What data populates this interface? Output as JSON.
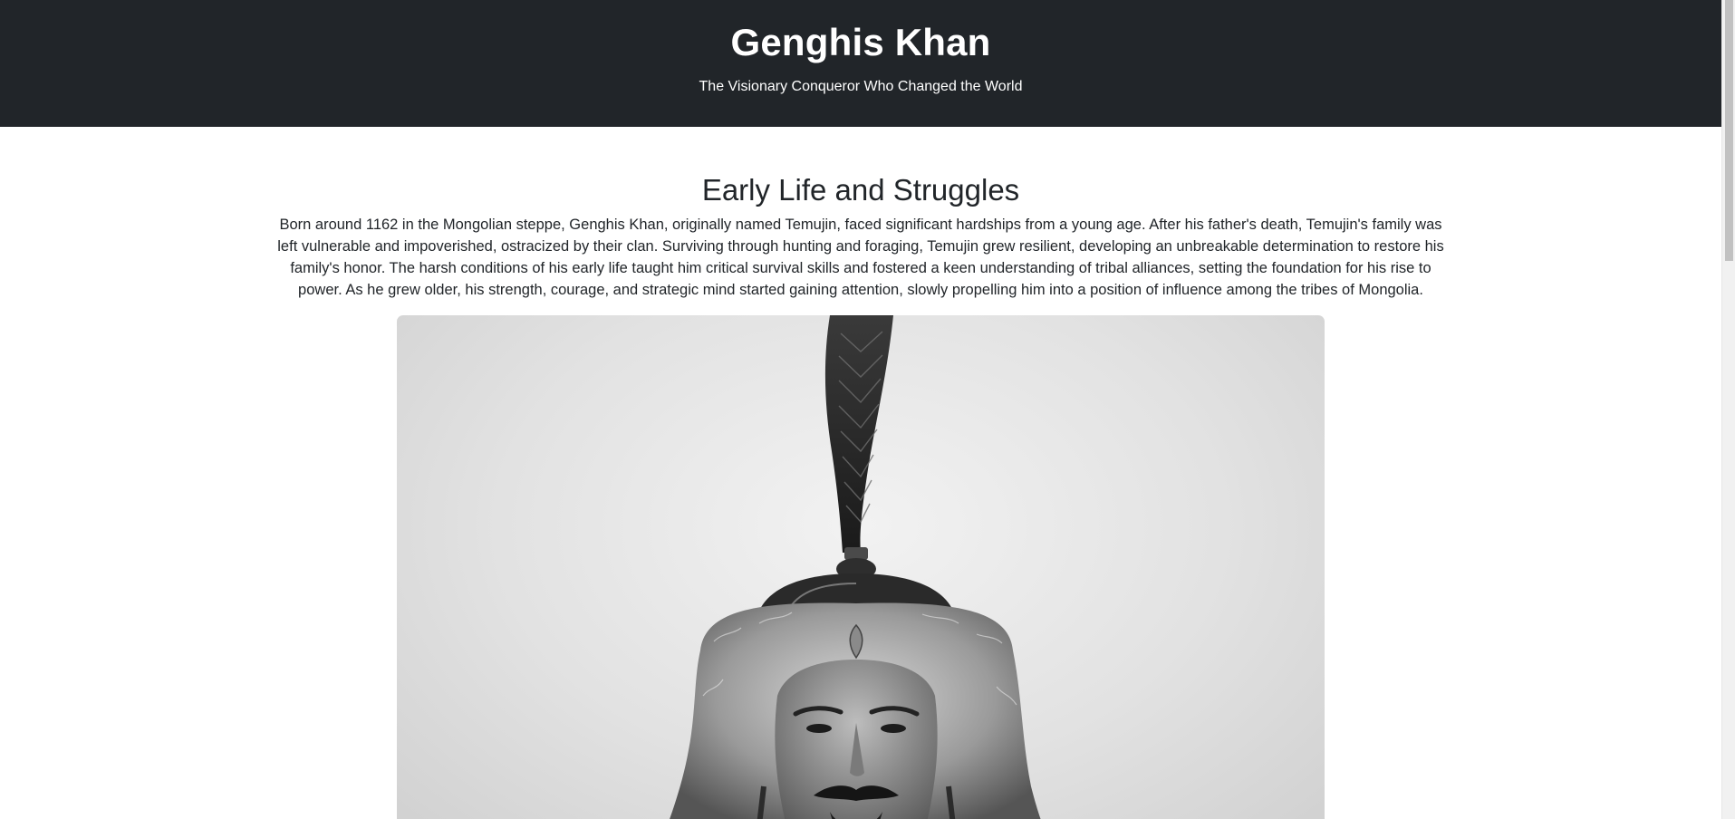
{
  "header": {
    "title": "Genghis Khan",
    "subtitle": "The Visionary Conqueror Who Changed the World"
  },
  "section": {
    "heading": "Early Life and Struggles",
    "body": "Born around 1162 in the Mongolian steppe, Genghis Khan, originally named Temujin, faced significant hardships from a young age. After his father's death, Temujin's family was left vulnerable and impoverished, ostracized by their clan. Surviving through hunting and foraging, Temujin grew resilient, developing an unbreakable determination to restore his family's honor. The harsh conditions of his early life taught him critical survival skills and fostered a keen understanding of tribal alliances, setting the foundation for his rise to power. As he grew older, his strength, courage, and strategic mind started gaining attention, slowly propelling him into a position of influence among the tribes of Mongolia."
  },
  "colors": {
    "header_bg": "#212529",
    "header_text": "#ffffff",
    "body_text": "#212529",
    "page_bg": "#ffffff"
  }
}
